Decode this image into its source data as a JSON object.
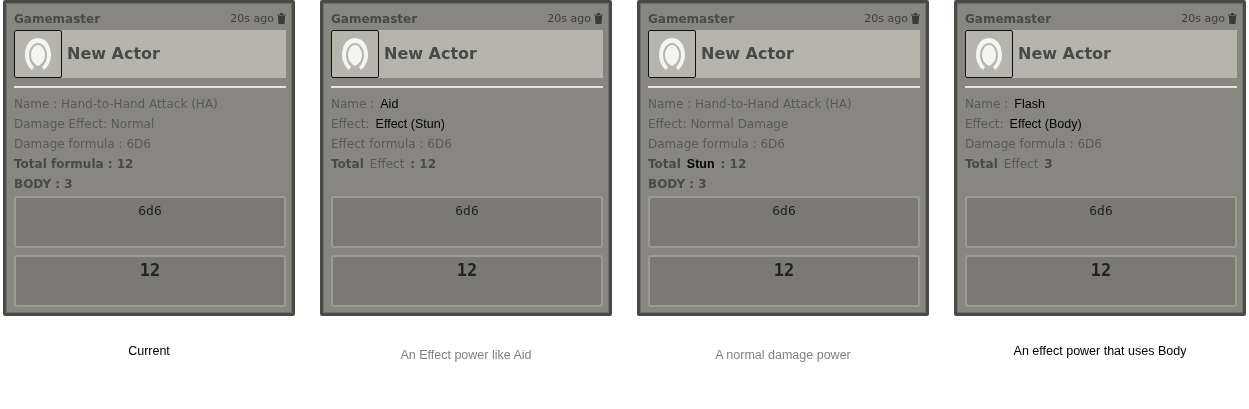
{
  "panels": [
    {
      "speaker": "Gamemaster",
      "time": "20s ago",
      "actor": "New Actor",
      "lines": [
        {
          "parts": [
            {
              "kind": "plain",
              "text": "Name : Hand-to-Hand Attack (HA)"
            }
          ]
        },
        {
          "parts": [
            {
              "kind": "plain",
              "text": "Damage Effect: Normal"
            }
          ]
        },
        {
          "parts": [
            {
              "kind": "plain",
              "text": "Damage formula : 6D6"
            }
          ]
        },
        {
          "parts": [
            {
              "kind": "bold",
              "text": "Total formula : 12"
            }
          ]
        },
        {
          "parts": [
            {
              "kind": "bold",
              "text": "BODY : 3"
            }
          ]
        }
      ],
      "formula": "6d6",
      "total": "12",
      "caption": {
        "text": "Current",
        "kind": "dark"
      }
    },
    {
      "speaker": "Gamemaster",
      "time": "20s ago",
      "actor": "New Actor",
      "lines": [
        {
          "parts": [
            {
              "kind": "plain",
              "text": "Name :"
            },
            {
              "kind": "pasted",
              "text": "Aid"
            }
          ]
        },
        {
          "parts": [
            {
              "kind": "plain",
              "text": "Effect:"
            },
            {
              "kind": "pasted",
              "text": "Effect (Stun)"
            }
          ]
        },
        {
          "parts": [
            {
              "kind": "plain",
              "text": "Effect formula : 6D6"
            }
          ]
        },
        {
          "parts": [
            {
              "kind": "bold",
              "text": "Total"
            },
            {
              "kind": "plain",
              "text": "Effect"
            },
            {
              "kind": "bold",
              "text": ": 12"
            }
          ]
        }
      ],
      "formula": "6d6",
      "total": "12",
      "caption": {
        "text": "An Effect power like Aid",
        "kind": "muted"
      }
    },
    {
      "speaker": "Gamemaster",
      "time": "20s ago",
      "actor": "New Actor",
      "lines": [
        {
          "parts": [
            {
              "kind": "plain",
              "text": "Name : Hand-to-Hand Attack (HA)"
            }
          ]
        },
        {
          "parts": [
            {
              "kind": "plain",
              "text": "Effect: Normal  Damage"
            }
          ]
        },
        {
          "parts": [
            {
              "kind": "plain",
              "text": "Damage formula : 6D6"
            }
          ]
        },
        {
          "parts": [
            {
              "kind": "bold",
              "text": "Total"
            },
            {
              "kind": "pasted-bold",
              "text": "Stun"
            },
            {
              "kind": "bold",
              "text": ": 12"
            }
          ]
        },
        {
          "parts": [
            {
              "kind": "bold",
              "text": "BODY : 3"
            }
          ]
        }
      ],
      "formula": "6d6",
      "total": "12",
      "caption": {
        "text": "A normal damage power",
        "kind": "muted"
      }
    },
    {
      "speaker": "Gamemaster",
      "time": "20s ago",
      "actor": "New Actor",
      "lines": [
        {
          "parts": [
            {
              "kind": "plain",
              "text": "Name :"
            },
            {
              "kind": "pasted",
              "text": "Flash"
            }
          ]
        },
        {
          "parts": [
            {
              "kind": "plain",
              "text": "Effect:"
            },
            {
              "kind": "pasted",
              "text": "Effect (Body)"
            }
          ]
        },
        {
          "parts": [
            {
              "kind": "plain",
              "text": "Damage formula : 6D6"
            }
          ]
        },
        {
          "parts": [
            {
              "kind": "bold",
              "text": "Total"
            },
            {
              "kind": "plain",
              "text": "Effect"
            },
            {
              "kind": "bold",
              "text": "3"
            }
          ]
        }
      ],
      "formula": "6d6",
      "total": "12",
      "caption": {
        "text": "An effect power that uses Body",
        "kind": "dark"
      }
    }
  ]
}
